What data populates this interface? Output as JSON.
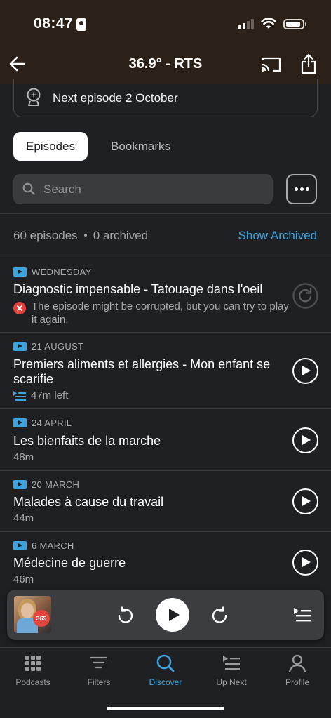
{
  "status_bar": {
    "time": "08:47"
  },
  "nav": {
    "title": "36.9° - RTS"
  },
  "next_episode": {
    "text": "Next episode 2 October"
  },
  "segments": {
    "episodes": "Episodes",
    "bookmarks": "Bookmarks",
    "selected": "Episodes"
  },
  "search": {
    "placeholder": "Search"
  },
  "summary": {
    "episodes_count": "60 episodes",
    "archived_count": "0 archived",
    "show_archived": "Show Archived"
  },
  "colors": {
    "accent": "#3ca5df",
    "background": "#1f2023",
    "error": "#e5403b"
  },
  "episodes": [
    {
      "date": "WEDNESDAY",
      "title": "Diagnostic impensable - Tatouage dans l'oeil",
      "error": "The episode might be corrupted, but you can try to play it again.",
      "action": "retry-icon"
    },
    {
      "date": "21 AUGUST",
      "title": "Premiers aliments et allergies - Mon enfant se scarifie",
      "meta": "47m left",
      "action": "play-icon"
    },
    {
      "date": "24 APRIL",
      "title": "Les bienfaits de la marche",
      "meta": "48m",
      "action": "play-icon"
    },
    {
      "date": "20 MARCH",
      "title": "Malades à cause du travail",
      "meta": "44m",
      "action": "play-icon"
    },
    {
      "date": "6 MARCH",
      "title": "Médecine de guerre",
      "meta": "46m",
      "action": "play-icon"
    }
  ],
  "mini_player": {
    "artwork_badge": "369"
  },
  "tabs": [
    {
      "label": "Podcasts",
      "icon": "grid-icon"
    },
    {
      "label": "Filters",
      "icon": "filter-icon"
    },
    {
      "label": "Discover",
      "icon": "search-icon",
      "active": true
    },
    {
      "label": "Up Next",
      "icon": "queue-icon"
    },
    {
      "label": "Profile",
      "icon": "profile-icon"
    }
  ]
}
